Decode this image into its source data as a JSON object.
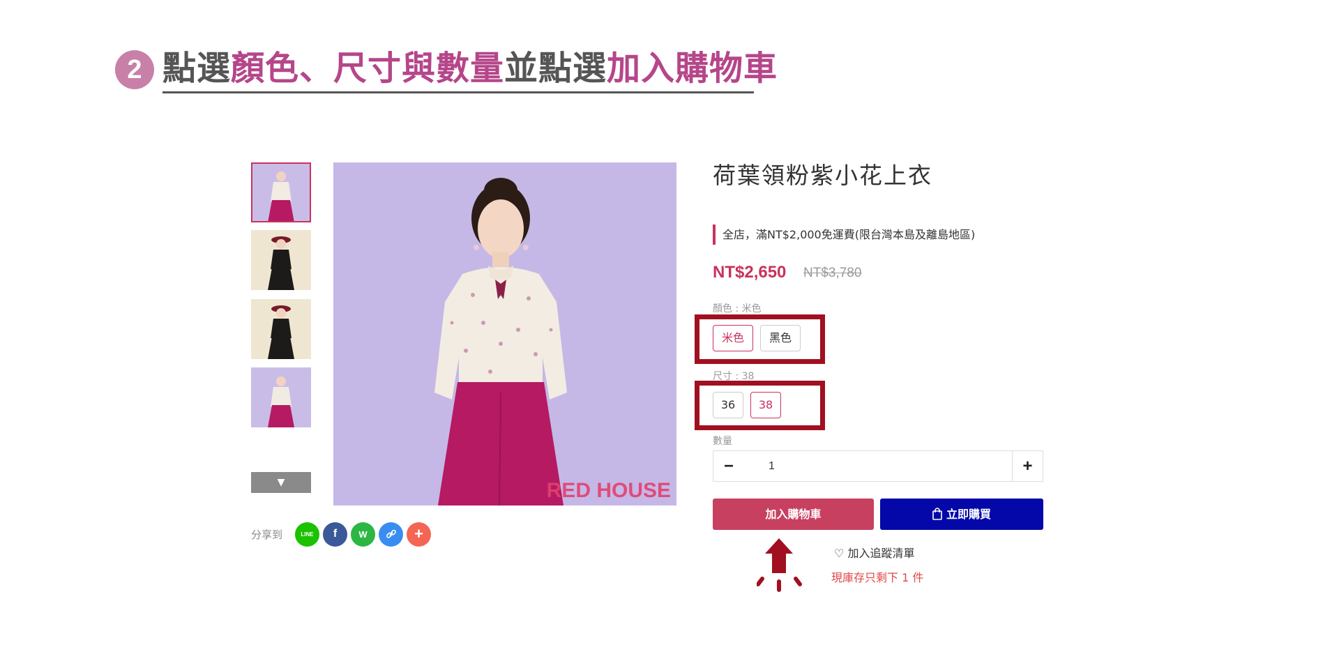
{
  "colors": {
    "accent": "#c9325d",
    "step_badge": "#c880a8",
    "title_gray": "#555555",
    "title_accent": "#b5468a",
    "buy_button": "#0508a8",
    "highlight_box": "#a01020",
    "image_background": "#c5b8e6",
    "skirt": "#b51a63"
  },
  "step": {
    "number": "2",
    "title_parts": [
      {
        "text": "點選",
        "accent": false
      },
      {
        "text": "顏色、尺寸與數量",
        "accent": true
      },
      {
        "text": "並點選",
        "accent": false
      },
      {
        "text": "加入購物車",
        "accent": true
      }
    ]
  },
  "gallery": {
    "thumbnails": [
      {
        "alt": "thumbnail-beige-top",
        "active": true,
        "bg": "#c9bde8",
        "outfit": "beige"
      },
      {
        "alt": "thumbnail-black-top",
        "active": false,
        "bg": "#efe6d2",
        "outfit": "black"
      },
      {
        "alt": "thumbnail-black-top-side",
        "active": false,
        "bg": "#efe6d2",
        "outfit": "black"
      },
      {
        "alt": "thumbnail-beige-top-2",
        "active": false,
        "bg": "#c9bde8",
        "outfit": "beige"
      }
    ],
    "down_icon": "caret-down-icon",
    "watermark": "RED HOUSE"
  },
  "share": {
    "label": "分享到",
    "buttons": [
      {
        "name": "line-share",
        "icon": "line-icon",
        "color": "#1cc100",
        "glyph": "LINE"
      },
      {
        "name": "facebook-share",
        "icon": "facebook-icon",
        "color": "#3b5998",
        "glyph": "f"
      },
      {
        "name": "whatsapp-share",
        "icon": "whatsapp-icon",
        "color": "#2cb742",
        "glyph": "W"
      },
      {
        "name": "link-share",
        "icon": "link-icon",
        "color": "#3a8df0",
        "glyph": "🔗"
      },
      {
        "name": "more-share",
        "icon": "plus-icon",
        "color": "#f46553",
        "glyph": "+"
      }
    ]
  },
  "product": {
    "title": "荷葉領粉紫小花上衣",
    "promo": "全店，滿NT$2,000免運費(限台灣本島及離島地區)",
    "price": "NT$2,650",
    "original_price": "NT$3,780",
    "color_label": "顏色 : 米色",
    "colors": [
      {
        "label": "米色",
        "selected": true
      },
      {
        "label": "黑色",
        "selected": false
      }
    ],
    "size_label": "尺寸 : 38",
    "sizes": [
      {
        "label": "36",
        "selected": false
      },
      {
        "label": "38",
        "selected": true
      }
    ],
    "quantity_label": "數量",
    "quantity": "1",
    "minus_icon": "minus-icon",
    "plus_icon": "plus-icon",
    "add_to_cart": "加入購物車",
    "buy_now": "立即購買",
    "buy_icon": "shopping-bag-icon",
    "wishlist": "加入追蹤清單",
    "wishlist_icon": "heart-outline-icon",
    "stock_note": "現庫存只剩下 1 件"
  },
  "annotation": {
    "arrow_icon": "up-arrow-icon",
    "arrow_color": "#a01020"
  }
}
